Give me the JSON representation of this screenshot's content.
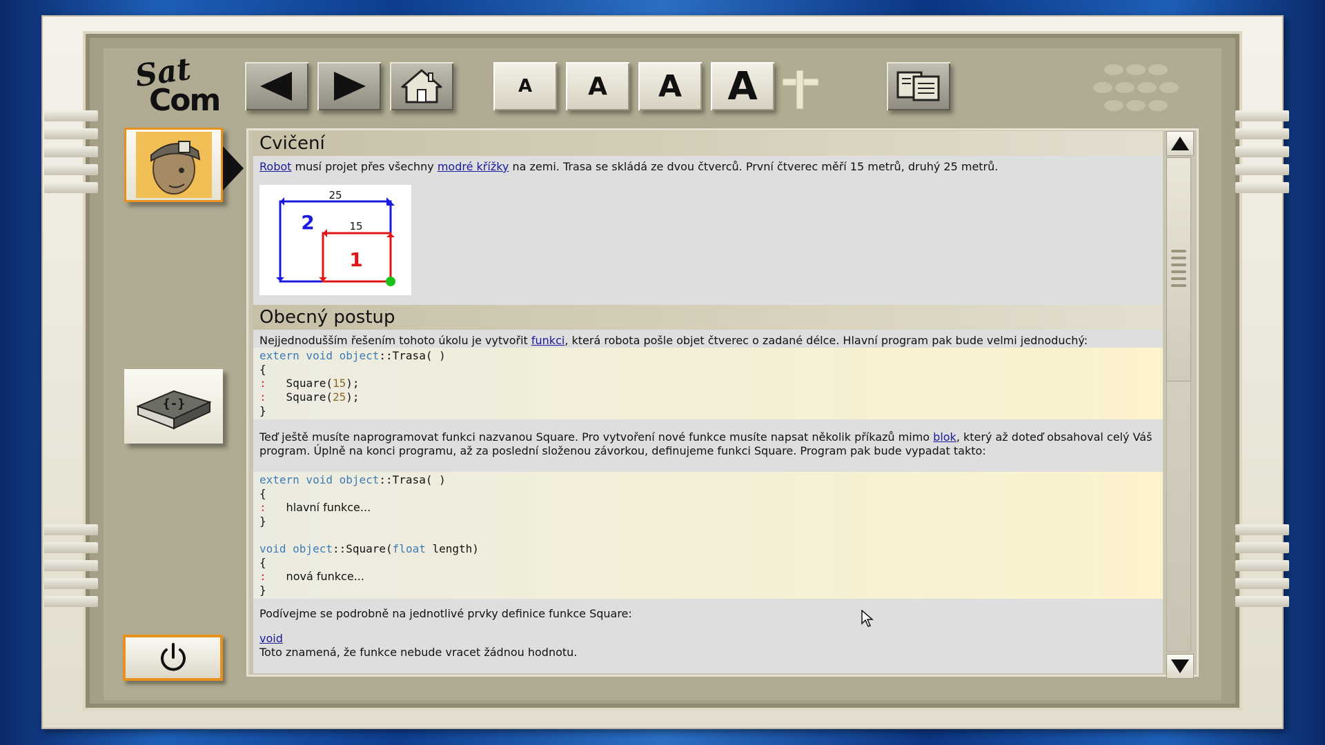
{
  "logo": {
    "text_top": "Sat",
    "text_bottom": "Com"
  },
  "toolbar": {
    "back_icon": "back-arrow-icon",
    "forward_icon": "forward-arrow-icon",
    "home_icon": "home-icon",
    "font_sizes": [
      "A",
      "A",
      "A",
      "A"
    ],
    "font_plus_icon": "plus-icon",
    "copy_icon": "copy-documents-icon"
  },
  "sidebar": {
    "avatar_icon": "robot-head-icon",
    "book_label": "{-}",
    "power_icon": "power-icon"
  },
  "sections": {
    "exercise_title": "Cvičení",
    "general_title": "Obecný postup"
  },
  "paragraph1": {
    "link_robot": "Robot",
    "t1": " musí projet přes všechny ",
    "link_crosses": "modré křížky",
    "t2": " na zemi. Trasa se skládá ze dvou čtverců. První čtverec měří 15 metrů, druhý 25 metrů."
  },
  "diagram": {
    "outer_label": "25",
    "inner_label": "15",
    "square_2": "2",
    "square_1": "1"
  },
  "paragraph2": {
    "t1": "Nejjednodušším řešením tohoto úkolu je vytvořit ",
    "link_function": "funkci",
    "t2": ", která robota pošle objet čtverec o zadané délce. Hlavní program pak bude velmi jednoduchý:"
  },
  "code1": {
    "kw1": "extern void object",
    "sig": "::Trasa( )",
    "open": "{",
    "call1_name": "Square(",
    "call1_arg": "15",
    "call1_end": ");",
    "call2_name": "Square(",
    "call2_arg": "25",
    "call2_end": ");",
    "close": "}",
    "bar": ":"
  },
  "paragraph3": {
    "t1": "Teď ještě musíte naprogramovat funkci nazvanou Square. Pro vytvoření nové funkce musíte napsat několik příkazů mimo ",
    "link_block": "blok",
    "t2": ", který až doteď obsahoval celý Váš program. Úplně na konci programu, až za poslední složenou závorkou, definujeme funkci Square. Program pak bude vypadat takto:"
  },
  "code2": {
    "kw1": "extern void object",
    "sig": "::Trasa( )",
    "open": "{",
    "body1": "hlavní funkce...",
    "close": "}",
    "kw2": "void object",
    "sig2": "::Square(",
    "kw3": "float",
    "sig2_end": " length)",
    "open2": "{",
    "body2": "nová funkce...",
    "close2": "}",
    "bar": ":"
  },
  "paragraph4": {
    "text": "Podívejme se podrobně na jednotlivé prvky definice funkce Square:"
  },
  "paragraph5": {
    "link_void": "void",
    "text": "Toto znamená, že funkce nebude vracet žádnou hodnotu."
  }
}
